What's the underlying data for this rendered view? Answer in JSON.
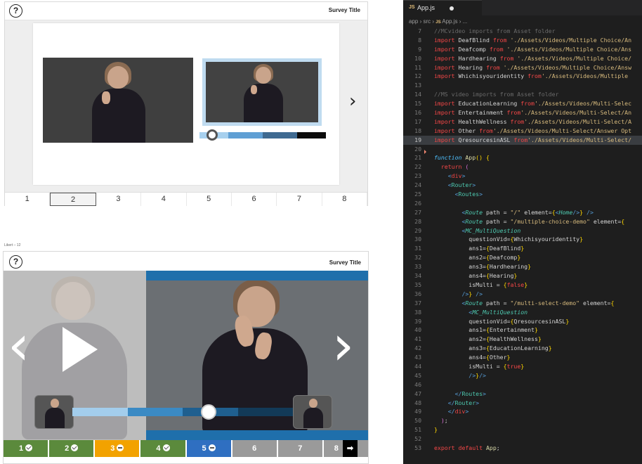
{
  "survey1": {
    "title": "Survey Title",
    "help_icon": "?",
    "next_icon": "›",
    "pages": [
      "1",
      "2",
      "3",
      "4",
      "5",
      "6",
      "7",
      "8"
    ],
    "selected_page": "2",
    "progress_colors": [
      "#a7d0ee",
      "#5f9fd4",
      "#3f6a91",
      "#0c0c0c"
    ]
  },
  "survey2": {
    "label": "Likert – 12",
    "title": "Survey Title",
    "help_icon": "?",
    "prev_icon": "‹",
    "next_icon": "›",
    "pages": [
      {
        "label": "1",
        "status": "complete",
        "color": "#5b8a3c"
      },
      {
        "label": "2",
        "status": "complete",
        "color": "#5b8a3c"
      },
      {
        "label": "3",
        "status": "partial",
        "color": "#f2a200"
      },
      {
        "label": "4",
        "status": "complete",
        "color": "#5b8a3c"
      },
      {
        "label": "5",
        "status": "current",
        "color": "#2f6fc1"
      },
      {
        "label": "6",
        "status": "none",
        "color": "#9a9a9a"
      },
      {
        "label": "7",
        "status": "none",
        "color": "#9a9a9a"
      },
      {
        "label": "8",
        "status": "none",
        "color": "#9a9a9a"
      }
    ],
    "next_page_arrow": "➡"
  },
  "editor": {
    "tab_icon": "JS",
    "tab_name": "App.js",
    "breadcrumb": [
      "app",
      "src",
      "App.js",
      "..."
    ],
    "lines": [
      {
        "n": "7",
        "html": "<span class='c'>//MCvideo imports from Asset folder</span>"
      },
      {
        "n": "8",
        "html": "<span class='k'>import</span> <span class='pl'>DeafBlind</span> <span class='k'>from</span> <span class='s'>'./Assets/Videos/Multiple Choice/An</span>"
      },
      {
        "n": "9",
        "html": "<span class='k'>import</span> <span class='pl'>Deafcomp</span> <span class='k'>from</span> <span class='s'>'./Assets/Videos/Multiple Choice/Ans</span>"
      },
      {
        "n": "10",
        "html": "<span class='k'>import</span> <span class='pl'>Hardhearing</span> <span class='k'>from</span> <span class='s'>'./Assets/Videos/Multiple Choice/</span>"
      },
      {
        "n": "11",
        "html": "<span class='k'>import</span> <span class='pl'>Hearing</span> <span class='k'>from</span> <span class='s'>'./Assets/Videos/Multiple Choice/Answ</span>"
      },
      {
        "n": "12",
        "html": "<span class='k'>import</span> <span class='pl'>Whichisyouridentity</span> <span class='k'>from</span><span class='s'>'./Assets/Videos/Multiple </span>"
      },
      {
        "n": "13",
        "html": ""
      },
      {
        "n": "14",
        "html": "<span class='c'>//MS video imports from Asset folder</span>"
      },
      {
        "n": "15",
        "html": "<span class='k'>import</span> <span class='pl'>EducationLearning</span> <span class='k'>from</span><span class='s'>'./Assets/Videos/Multi-Selec</span>"
      },
      {
        "n": "16",
        "html": "<span class='k'>import</span> <span class='pl'>Entertainment</span> <span class='k'>from</span><span class='s'>'./Assets/Videos/Multi-Select/An</span>"
      },
      {
        "n": "17",
        "html": "<span class='k'>import</span> <span class='pl'>HealthWellness</span> <span class='k'>from</span><span class='s'>'./Assets/Videos/Multi-Select/A</span>"
      },
      {
        "n": "18",
        "html": "<span class='k'>import</span> <span class='pl'>Other</span> <span class='k'>from</span><span class='s'>'./Assets/Videos/Multi-Select/Answer Opt</span>"
      },
      {
        "n": "19",
        "html": "<span class='k'>import</span> <span class='pl'>QresourcesinASL</span> <span class='k'>from</span><span class='s'>'./Assets/Videos/Multi-Select/</span>",
        "hl": true
      },
      {
        "n": "20",
        "html": ""
      },
      {
        "n": "21",
        "html": "<span class='fn'>function</span> <span class='id'>App</span><span class='br'>()</span> <span class='br'>{</span>"
      },
      {
        "n": "22",
        "html": "  <span class='k'>return</span> <span class='br2'>(</span>"
      },
      {
        "n": "23",
        "html": "    <span class='tag'>&lt;</span><span class='k'>div</span><span class='tag'>&gt;</span>"
      },
      {
        "n": "24",
        "html": "    <span class='tag'>&lt;</span><span class='attr'>Router</span><span class='tag'>&gt;</span>"
      },
      {
        "n": "25",
        "html": "      <span class='tag'>&lt;</span><span class='attr'>Routes</span><span class='tag'>&gt;</span>"
      },
      {
        "n": "26",
        "html": ""
      },
      {
        "n": "27",
        "html": "        <span class='tag'>&lt;</span><span class='tg'>Route</span> <span class='pl'>path</span> <span class='pl'>=</span> <span class='s'>\"/\"</span> <span class='pl'>element</span><span class='pl'>=</span><span class='br'>{</span><span class='tag'>&lt;</span><span class='tg'>Home</span><span class='tag'>/&gt;</span><span class='br'>}</span> <span class='tag'>/&gt;</span>"
      },
      {
        "n": "28",
        "html": "        <span class='tag'>&lt;</span><span class='tg'>Route</span> <span class='pl'>path</span> <span class='pl'>=</span> <span class='s'>\"/multiple-choice-demo\"</span> <span class='pl'>element</span><span class='pl'>=</span><span class='br'>{</span>"
      },
      {
        "n": "29",
        "html": "        <span class='tag'>&lt;</span><span class='tg'>MC_MultiQuestion</span>"
      },
      {
        "n": "30",
        "html": "          <span class='pl'>questionVid</span><span class='pl'>=</span><span class='br'>{</span><span class='pl'>Whichisyouridentity</span><span class='br'>}</span>"
      },
      {
        "n": "31",
        "html": "          <span class='pl'>ans1</span><span class='pl'>=</span><span class='br'>{</span><span class='pl'>DeafBlind</span><span class='br'>}</span>"
      },
      {
        "n": "32",
        "html": "          <span class='pl'>ans2</span><span class='pl'>=</span><span class='br'>{</span><span class='pl'>Deafcomp</span><span class='br'>}</span>"
      },
      {
        "n": "33",
        "html": "          <span class='pl'>ans3</span><span class='pl'>=</span><span class='br'>{</span><span class='pl'>Hardhearing</span><span class='br'>}</span>"
      },
      {
        "n": "34",
        "html": "          <span class='pl'>ans4</span><span class='pl'>=</span><span class='br'>{</span><span class='pl'>Hearing</span><span class='br'>}</span>"
      },
      {
        "n": "35",
        "html": "          <span class='pl'>isMulti</span> <span class='pl'>=</span> <span class='br'>{</span><span class='k'>false</span><span class='br'>}</span>"
      },
      {
        "n": "36",
        "html": "        <span class='tag'>/&gt;</span><span class='br'>}</span> <span class='tag'>/&gt;</span>"
      },
      {
        "n": "37",
        "html": "        <span class='tag'>&lt;</span><span class='tg'>Route</span> <span class='pl'>path</span> <span class='pl'>=</span> <span class='s'>\"/multi-select-demo\"</span> <span class='pl'>element</span><span class='pl'>=</span><span class='br'>{</span>"
      },
      {
        "n": "38",
        "html": "          <span class='tag'>&lt;</span><span class='tg'>MC_MultiQuestion</span>"
      },
      {
        "n": "39",
        "html": "          <span class='pl'>questionVid</span><span class='pl'>=</span><span class='br'>{</span><span class='pl'>QresourcesinASL</span><span class='br'>}</span>"
      },
      {
        "n": "40",
        "html": "          <span class='pl'>ans1</span><span class='pl'>=</span><span class='br'>{</span><span class='pl'>Entertainment</span><span class='br'>}</span>"
      },
      {
        "n": "41",
        "html": "          <span class='pl'>ans2</span><span class='pl'>=</span><span class='br'>{</span><span class='pl'>HealthWellness</span><span class='br'>}</span>"
      },
      {
        "n": "42",
        "html": "          <span class='pl'>ans3</span><span class='pl'>=</span><span class='br'>{</span><span class='pl'>EducationLearning</span><span class='br'>}</span>"
      },
      {
        "n": "43",
        "html": "          <span class='pl'>ans4</span><span class='pl'>=</span><span class='br'>{</span><span class='pl'>Other</span><span class='br'>}</span>"
      },
      {
        "n": "44",
        "html": "          <span class='pl'>isMulti</span> <span class='pl'>=</span> <span class='br'>{</span><span class='k'>true</span><span class='br'>}</span>"
      },
      {
        "n": "45",
        "html": "          <span class='tag'>/&gt;</span><span class='br'>}</span><span class='tag'>/&gt;</span>"
      },
      {
        "n": "46",
        "html": ""
      },
      {
        "n": "47",
        "html": "      <span class='tag'>&lt;/</span><span class='attr'>Routes</span><span class='tag'>&gt;</span>"
      },
      {
        "n": "48",
        "html": "    <span class='tag'>&lt;/</span><span class='attr'>Router</span><span class='tag'>&gt;</span>"
      },
      {
        "n": "49",
        "html": "    <span class='tag'>&lt;/</span><span class='k'>div</span><span class='tag'>&gt;</span>"
      },
      {
        "n": "50",
        "html": "  <span class='br2'>)</span><span class='pl'>;</span>"
      },
      {
        "n": "51",
        "html": "<span class='br'>}</span>"
      },
      {
        "n": "52",
        "html": ""
      },
      {
        "n": "53",
        "html": "<span class='k'>export</span> <span class='k'>default</span> <span class='id'>App</span><span class='pl'>;</span>"
      }
    ]
  }
}
